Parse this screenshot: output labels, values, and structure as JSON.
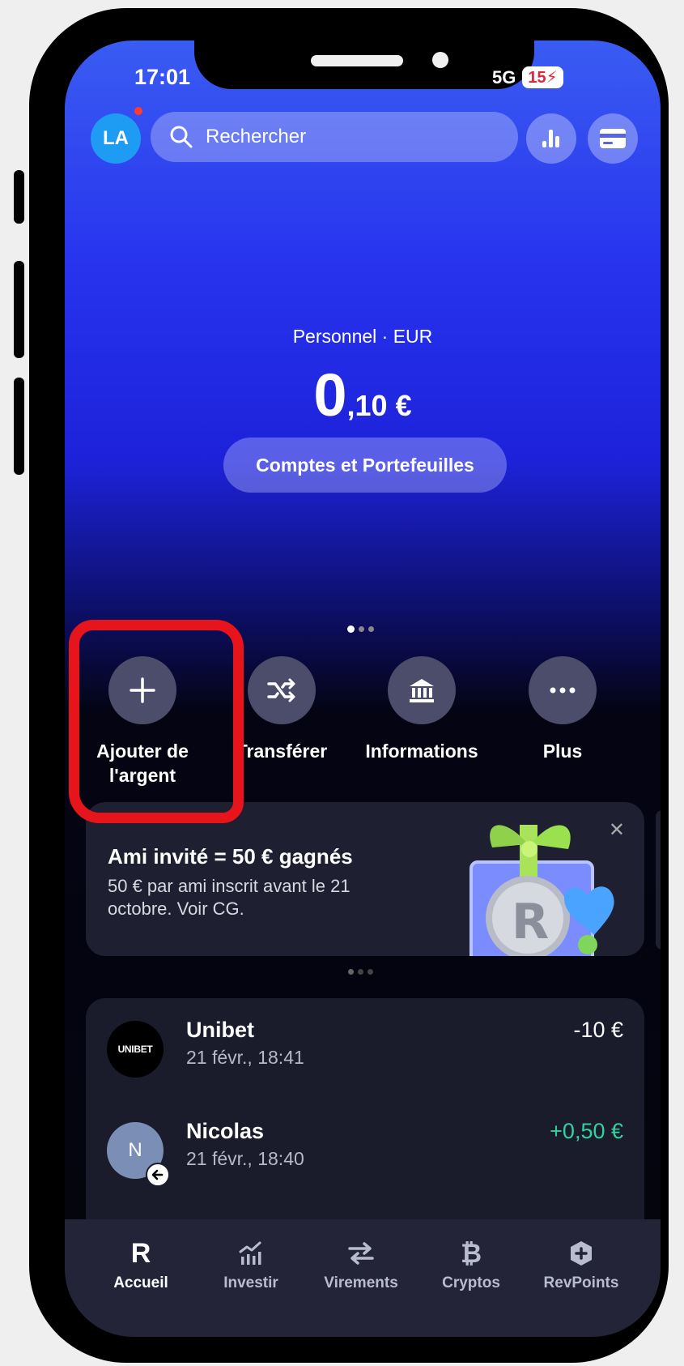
{
  "status_bar": {
    "time": "17:01",
    "network": "5G",
    "battery": "15"
  },
  "header": {
    "avatar_initials": "LA",
    "search_placeholder": "Rechercher"
  },
  "balance": {
    "account_label": "Personnel · EUR",
    "integer": "0",
    "decimal": ",10 €"
  },
  "accounts_button": "Comptes et Portefeuilles",
  "actions": [
    {
      "label": "Ajouter de l'argent"
    },
    {
      "label": "Transférer"
    },
    {
      "label": "Informations"
    },
    {
      "label": "Plus"
    }
  ],
  "promo": {
    "title": "Ami invité = 50 € gagnés",
    "description": "50 € par ami inscrit avant le 21 octobre. Voir CG."
  },
  "transactions": [
    {
      "name": "Unibet",
      "date": "21 févr., 18:41",
      "amount": "-10 €",
      "logo_text": "UNIBET"
    },
    {
      "name": "Nicolas",
      "date": "21 févr., 18:40",
      "amount": "+0,50 €",
      "avatar_initial": "N"
    }
  ],
  "colors": {
    "positive": "#2fd3a0",
    "highlight": "#e8141c",
    "accent": "#1e9bf2"
  },
  "tabs": [
    {
      "label": "Accueil",
      "icon": "revolut-r-icon",
      "active": true
    },
    {
      "label": "Investir",
      "icon": "chart-icon"
    },
    {
      "label": "Virements",
      "icon": "transfer-arrows-icon"
    },
    {
      "label": "Cryptos",
      "icon": "bitcoin-icon"
    },
    {
      "label": "RevPoints",
      "icon": "revpoints-icon"
    }
  ]
}
